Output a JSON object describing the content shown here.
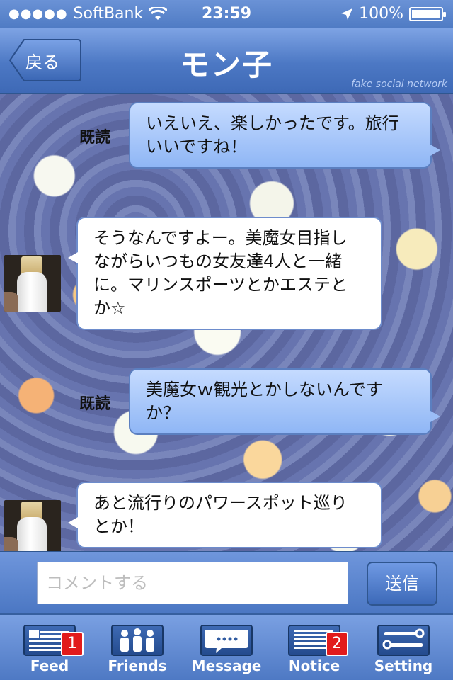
{
  "status_bar": {
    "carrier": "SoftBank",
    "signal_dots": "●●●●●",
    "time": "23:59",
    "battery": "100%"
  },
  "nav": {
    "back_label": "戻る",
    "title": "モン子",
    "watermark": "fake social network"
  },
  "messages": [
    {
      "direction": "outgoing",
      "read_label": "既読",
      "lines": [
        "いえいえ、楽しかったです。旅行",
        "いいですね！"
      ]
    },
    {
      "direction": "incoming",
      "lines": [
        "そうなんですよー。美魔女目指し",
        "ながらいつもの女友達4人と一緒",
        "に。マリンスポーツとかエステと",
        "か☆"
      ]
    },
    {
      "direction": "outgoing",
      "read_label": "既読",
      "lines": [
        "美魔女ｗ観光とかしないんです",
        "か？"
      ]
    },
    {
      "direction": "incoming",
      "lines": [
        "あと流行りのパワースポット巡り",
        "とか！"
      ]
    }
  ],
  "composer": {
    "placeholder": "コメントする",
    "value": "",
    "send_label": "送信"
  },
  "tabs": [
    {
      "key": "feed",
      "label": "Feed",
      "icon": "feed-icon",
      "badge": "1"
    },
    {
      "key": "friends",
      "label": "Friends",
      "icon": "friends-icon",
      "badge": ""
    },
    {
      "key": "message",
      "label": "Message",
      "icon": "message-icon",
      "badge": ""
    },
    {
      "key": "notice",
      "label": "Notice",
      "icon": "notice-icon",
      "badge": "2"
    },
    {
      "key": "setting",
      "label": "Setting",
      "icon": "setting-icon",
      "badge": ""
    }
  ],
  "colors": {
    "bar_blue": "#4f7bc4",
    "outgoing_bubble": "#9bbdf6",
    "incoming_bubble": "#ffffff",
    "badge_red": "#e21b1b"
  }
}
